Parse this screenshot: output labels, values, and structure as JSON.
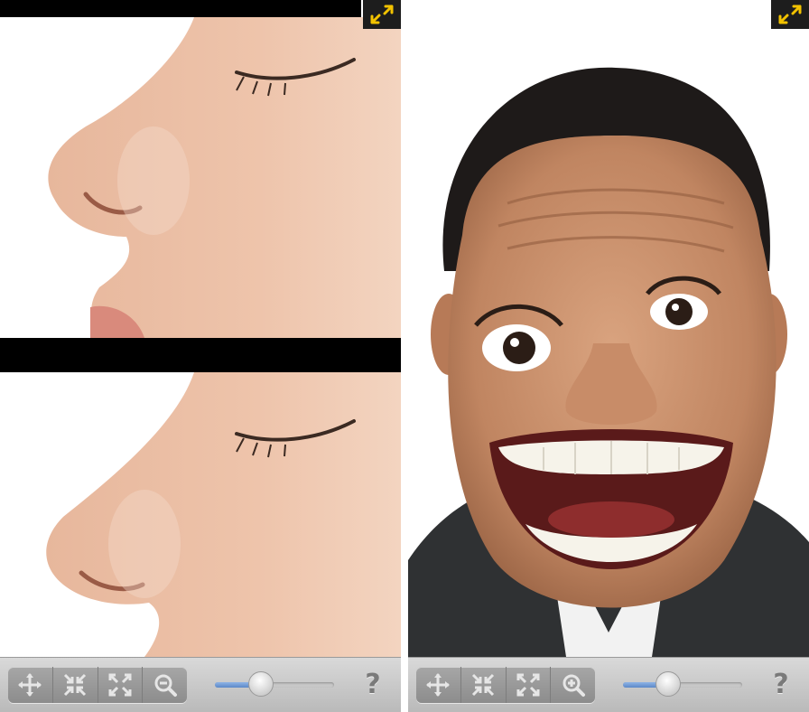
{
  "left_panel": {
    "toolbar": {
      "tools": [
        "move-icon",
        "shrink-icon",
        "expand-icon",
        "zoom-out-icon"
      ],
      "slider_level": 0.39,
      "help_label": "?"
    },
    "photos": [
      "nose-before",
      "nose-after"
    ]
  },
  "right_panel": {
    "toolbar": {
      "tools": [
        "move-icon",
        "shrink-icon",
        "expand-icon",
        "zoom-in-icon"
      ],
      "slider_level": 0.38,
      "help_label": "?"
    },
    "photo": "funny-face"
  },
  "colors": {
    "accent": "#f2c200",
    "toolbar": "#c8c8c8",
    "slider_fill": "#6f98d4"
  }
}
